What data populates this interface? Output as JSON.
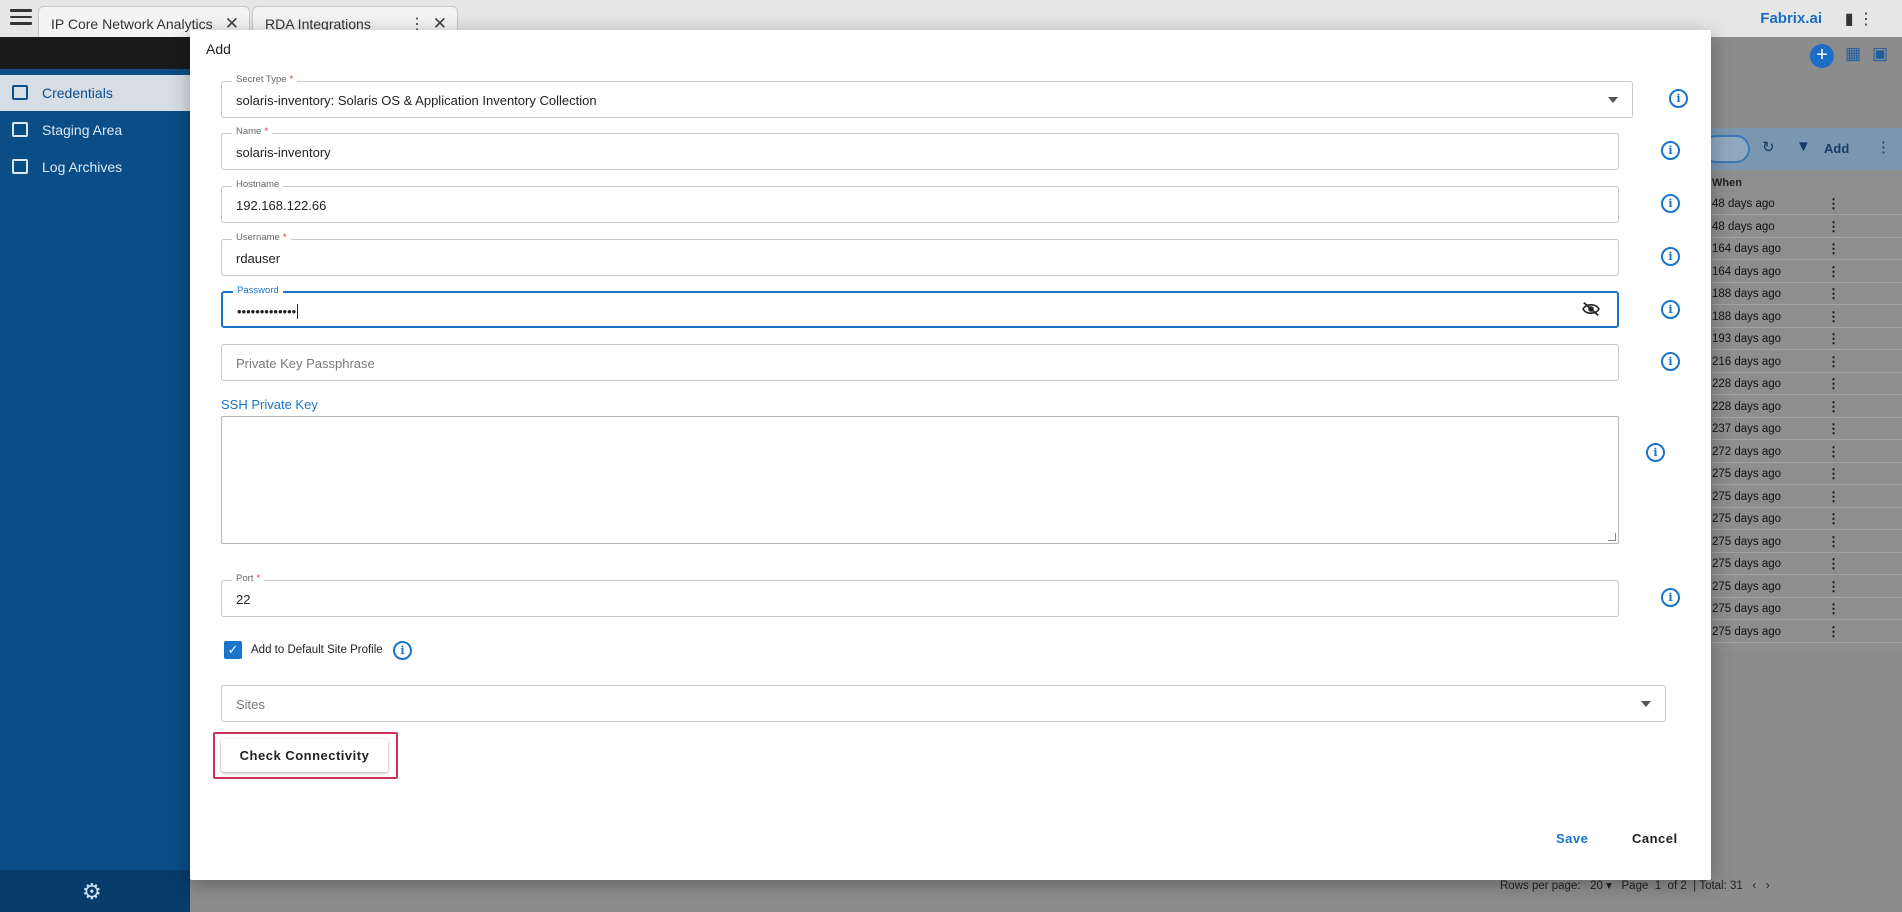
{
  "app": {
    "tabs": [
      {
        "label": "IP Core Network Analytics"
      },
      {
        "label": "RDA Integrations"
      }
    ],
    "brand": "Fabrix.ai",
    "sidebar": {
      "items": [
        {
          "label": "Credentials",
          "icon": "credentials-icon"
        },
        {
          "label": "Staging Area",
          "icon": "database-icon"
        },
        {
          "label": "Log Archives",
          "icon": "archive-icon"
        }
      ]
    },
    "toolbar": {
      "add_label": "Add"
    },
    "table": {
      "when_header": "When",
      "rows": [
        "48 days ago",
        "48 days ago",
        "164 days ago",
        "164 days ago",
        "188 days ago",
        "188 days ago",
        "193 days ago",
        "216 days ago",
        "228 days ago",
        "228 days ago",
        "237 days ago",
        "272 days ago",
        "275 days ago",
        "275 days ago",
        "275 days ago",
        "275 days ago",
        "275 days ago",
        "275 days ago",
        "275 days ago",
        "275 days ago"
      ]
    },
    "pager": {
      "rows_per_page_label": "Rows per page:",
      "rows_per_page": "20",
      "page_label": "Page",
      "page": "1",
      "of_pages": "of 2",
      "total": "Total: 31"
    }
  },
  "dialog": {
    "title": "Add",
    "secret_type": {
      "label": "Secret Type",
      "value": "solaris-inventory: Solaris OS & Application Inventory Collection"
    },
    "name": {
      "label": "Name",
      "value": "solaris-inventory"
    },
    "hostname": {
      "label": "Hostname",
      "value": "192.168.122.66"
    },
    "username": {
      "label": "Username",
      "value": "rdauser"
    },
    "password": {
      "label": "Password",
      "value": "•••••••••••••"
    },
    "passphrase": {
      "placeholder": "Private Key Passphrase"
    },
    "ssh_key": {
      "label": "SSH Private Key",
      "value": ""
    },
    "port": {
      "label": "Port",
      "value": "22"
    },
    "default_site_profile": {
      "label": "Add to Default Site Profile",
      "checked": true
    },
    "sites": {
      "placeholder": "Sites"
    },
    "check_connectivity_label": "Check Connectivity",
    "save_label": "Save",
    "cancel_label": "Cancel"
  },
  "colors": {
    "accent": "#1a74c9",
    "sidebar": "#0b4d86",
    "highlight": "#d0305a",
    "required": "#d32f2f"
  }
}
